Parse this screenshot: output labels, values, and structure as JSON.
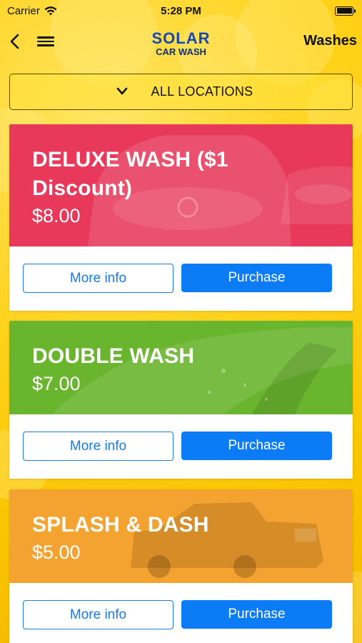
{
  "status_bar": {
    "carrier": "Carrier",
    "time": "5:28 PM"
  },
  "nav": {
    "logo_top": "SOLAR",
    "logo_bottom": "CAR WASH",
    "title": "Washes"
  },
  "location_selector": {
    "label": "ALL LOCATIONS"
  },
  "washes": [
    {
      "title": "DELUXE WASH ($1 Discount)",
      "price": "$8.00",
      "more_info_label": "More info",
      "purchase_label": "Purchase",
      "color": "#e8395a"
    },
    {
      "title": "DOUBLE WASH",
      "price": "$7.00",
      "more_info_label": "More info",
      "purchase_label": "Purchase",
      "color": "#6ab52e"
    },
    {
      "title": "SPLASH & DASH",
      "price": "$5.00",
      "more_info_label": "More info",
      "purchase_label": "Purchase",
      "color": "#f5a330"
    }
  ],
  "colors": {
    "accent": "#0b7cf5",
    "background": "#ffd21a",
    "logo_blue": "#1447b8"
  },
  "icons": {
    "back": "chevron-left-icon",
    "menu": "hamburger-menu-icon",
    "dropdown": "chevron-down-icon",
    "wifi": "wifi-icon",
    "battery": "battery-icon"
  }
}
